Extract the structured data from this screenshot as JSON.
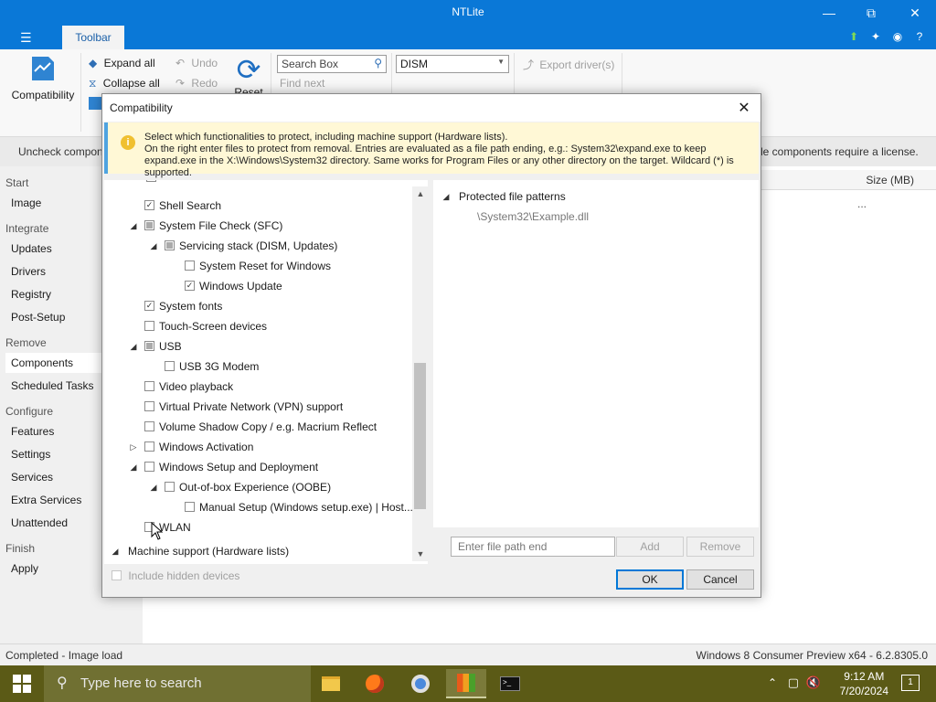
{
  "window": {
    "title": "NTLite"
  },
  "tabs": {
    "active": "Toolbar"
  },
  "ribbon": {
    "compatibility": "Compatibility",
    "expand_all": "Expand all",
    "collapse_all": "Collapse all",
    "undo": "Undo",
    "redo": "Redo",
    "reset": "Reset",
    "search_placeholder": "Search Box",
    "find_next": "Find next",
    "filter_value": "DISM",
    "export_drivers": "Export driver(s)"
  },
  "infobar": {
    "left": "Uncheck compon",
    "right": "le components require a license."
  },
  "sidebar": {
    "sections": [
      {
        "head": "Start",
        "items": [
          "Image"
        ]
      },
      {
        "head": "Integrate",
        "items": [
          "Updates",
          "Drivers",
          "Registry",
          "Post-Setup"
        ]
      },
      {
        "head": "Remove",
        "items": [
          "Components",
          "Scheduled Tasks"
        ]
      },
      {
        "head": "Configure",
        "items": [
          "Features",
          "Settings",
          "Services",
          "Extra Services",
          "Unattended"
        ]
      },
      {
        "head": "Finish",
        "items": [
          "Apply"
        ]
      }
    ]
  },
  "main": {
    "size_header": "Size (MB)",
    "ellipsis": "..."
  },
  "status": {
    "left": "Completed - Image load",
    "right": "Windows 8 Consumer Preview x64 - 6.2.8305.0"
  },
  "taskbar": {
    "search_placeholder": "Type here to search",
    "time": "9:12 AM",
    "date": "7/20/2024",
    "notification_count": "1"
  },
  "dialog": {
    "title": "Compatibility",
    "info_text": "Select which functionalities to protect, including machine support (Hardware lists).\nOn the right enter files to protect from removal. Entries are evaluated as a file path ending, e.g.: System32\\expand.exe to keep expand.exe in the X:\\Windows\\System32 directory. Same works for Program Files or any other directory on the target. Wildcard (*) is supported.",
    "tree": [
      {
        "label": "Shell Search",
        "state": "checked",
        "level": 0,
        "expander": ""
      },
      {
        "label": "System File Check (SFC)",
        "state": "partial",
        "level": 0,
        "expander": "expanded"
      },
      {
        "label": "Servicing stack (DISM, Updates)",
        "state": "partial",
        "level": 1,
        "expander": "expanded"
      },
      {
        "label": "System Reset for Windows",
        "state": "unchecked",
        "level": 2,
        "expander": ""
      },
      {
        "label": "Windows Update",
        "state": "checked",
        "level": 2,
        "expander": ""
      },
      {
        "label": "System fonts",
        "state": "checked",
        "level": 0,
        "expander": ""
      },
      {
        "label": "Touch-Screen devices",
        "state": "unchecked",
        "level": 0,
        "expander": ""
      },
      {
        "label": "USB",
        "state": "partial",
        "level": 0,
        "expander": "expanded"
      },
      {
        "label": "USB 3G Modem",
        "state": "unchecked",
        "level": 1,
        "expander": ""
      },
      {
        "label": "Video playback",
        "state": "unchecked",
        "level": 0,
        "expander": ""
      },
      {
        "label": "Virtual Private Network (VPN) support",
        "state": "unchecked",
        "level": 0,
        "expander": ""
      },
      {
        "label": "Volume Shadow Copy / e.g. Macrium Reflect",
        "state": "unchecked",
        "level": 0,
        "expander": ""
      },
      {
        "label": "Windows Activation",
        "state": "unchecked",
        "level": 0,
        "expander": "collapsed"
      },
      {
        "label": "Windows Setup and Deployment",
        "state": "unchecked",
        "level": 0,
        "expander": "expanded"
      },
      {
        "label": "Out-of-box Experience (OOBE)",
        "state": "unchecked",
        "level": 1,
        "expander": "expanded"
      },
      {
        "label": "Manual Setup (Windows setup.exe) | Host...",
        "state": "unchecked",
        "level": 2,
        "expander": ""
      },
      {
        "label": "WLAN",
        "state": "unchecked",
        "level": 0,
        "expander": ""
      }
    ],
    "machine_support": "Machine support (Hardware lists)",
    "patterns_header": "Protected file patterns",
    "pattern_example": "\\System32\\Example.dll",
    "file_input_placeholder": "Enter file path end",
    "add": "Add",
    "remove": "Remove",
    "include_hidden": "Include hidden devices",
    "ok": "OK",
    "cancel": "Cancel"
  }
}
